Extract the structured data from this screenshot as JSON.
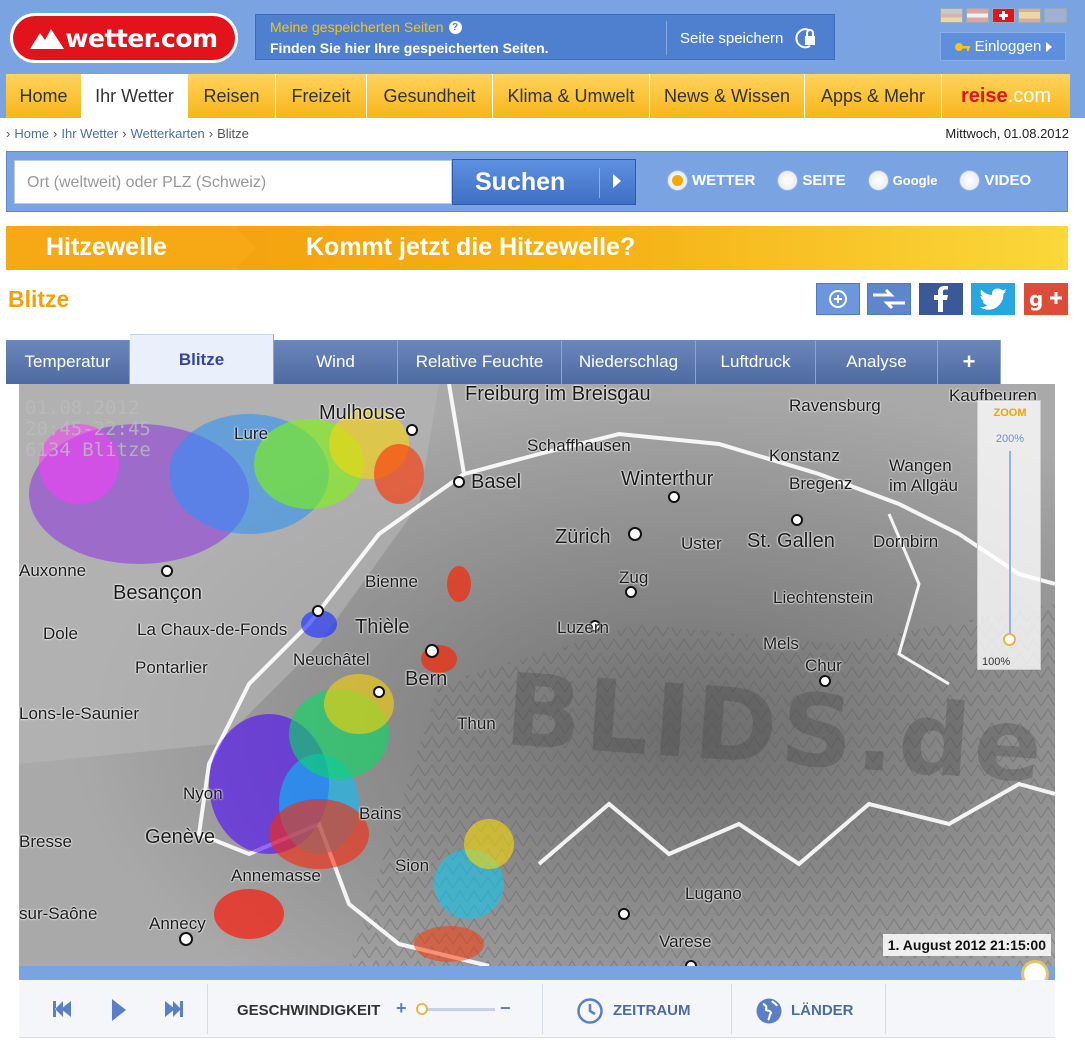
{
  "header": {
    "logo": "wetter.com",
    "saved_title": "Meine gespeicherten Seiten",
    "saved_subtitle": "Finden Sie hier Ihre gespeicherten Seiten.",
    "save_button": "Seite speichern",
    "login": "Einloggen"
  },
  "nav": {
    "items": [
      "Home",
      "Ihr Wetter",
      "Reisen",
      "Freizeit",
      "Gesundheit",
      "Klima & Umwelt",
      "News & Wissen",
      "Apps & Mehr"
    ],
    "active": "Ihr Wetter",
    "reise_brand": "reise",
    "reise_tld": ".com"
  },
  "breadcrumb": [
    "Home",
    "Ihr Wetter",
    "Wetterkarten",
    "Blitze"
  ],
  "date": "Mittwoch, 01.08.2012",
  "search": {
    "placeholder": "Ort (weltweit) oder PLZ (Schweiz)",
    "button": "Suchen",
    "options": [
      {
        "label": "WETTER",
        "checked": true
      },
      {
        "label": "SEITE",
        "checked": false
      },
      {
        "label": "Google",
        "checked": false
      },
      {
        "label": "VIDEO",
        "checked": false
      }
    ]
  },
  "banner": {
    "left": "Hitzewelle",
    "right": "Kommt jetzt die Hitzewelle?"
  },
  "page_title": "Blitze",
  "tabs": {
    "items": [
      "Temperatur",
      "Blitze",
      "Wind",
      "Relative Feuchte",
      "Niederschlag",
      "Luftdruck",
      "Analyse",
      "+"
    ],
    "active": "Blitze"
  },
  "map": {
    "overlay_lines": [
      "01.08.2012",
      "20:45-22:45",
      "6134 Blitze"
    ],
    "watermark": "BLIDS.de",
    "timestamp": "1. August 2012 21:15:00",
    "zoom_title": "ZOOM",
    "zoom_max": "200%",
    "zoom_min": "100%",
    "zoom_level_percent": 100,
    "cities": [
      "Freiburg im Breisgau",
      "Ravensburg",
      "Kaufbeuren",
      "Schaffhausen",
      "Konstanz",
      "Wangen im Allgäu",
      "Mulhouse",
      "Basel",
      "Winterthur",
      "Bregenz",
      "Lure",
      "Zürich",
      "Uster",
      "St. Gallen",
      "Dornbirn",
      "Besançon",
      "Bienne",
      "Zug",
      "Liechtenstein",
      "Auxonne",
      "Dole",
      "La Chaux-de-Fonds",
      "Thièle",
      "Luzern",
      "Mels",
      "Pontarlier",
      "Neuchâtel",
      "Chur",
      "Bern",
      "Lons-le-Saunier",
      "Thun",
      "Nyon",
      "Genève",
      "Bresse",
      "Annecy",
      "Sion",
      "Lugano",
      "Annemasse",
      "Varese",
      "sur-Saône",
      "Bains"
    ]
  },
  "controls": {
    "speed_label": "GESCHWINDIGKEIT",
    "speed_plus": "+",
    "speed_minus": "−",
    "zeitraum": "ZEITRAUM",
    "laender": "LÄNDER"
  },
  "colors": {
    "header_blue": "#7aa3e2",
    "nav_yellow": "#f7b61a",
    "brand_red": "#e3131c",
    "title_orange": "#f2a10a",
    "tab_blue": "#4d6aa3"
  }
}
